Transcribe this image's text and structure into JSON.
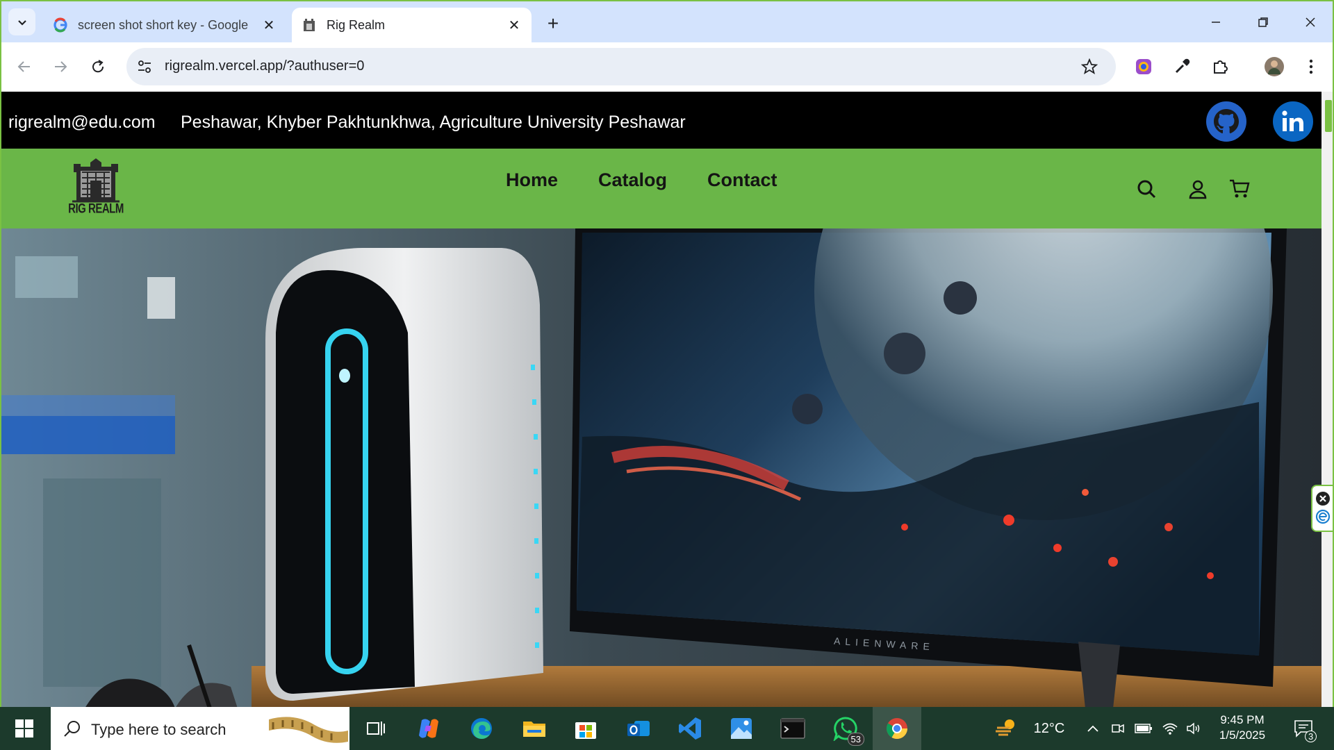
{
  "browser": {
    "tabs": [
      {
        "title": "screen shot short key - Google",
        "active": false
      },
      {
        "title": "Rig Realm",
        "active": true
      }
    ],
    "url": "rigrealm.vercel.app/?authuser=0"
  },
  "site": {
    "topbar": {
      "email": "rigrealm@edu.com",
      "address": "Peshawar, Khyber Pakhtunkhwa, Agriculture University Peshawar"
    },
    "logo_text": "RIG REALM",
    "nav": [
      {
        "label": "Home"
      },
      {
        "label": "Catalog"
      },
      {
        "label": "Contact"
      }
    ],
    "hero_monitor_brand": "ALIENWARE"
  },
  "colors": {
    "nav_green": "#6ab648",
    "topbar_black": "#000000",
    "github_blue": "#2563c9",
    "linkedin_blue": "#0a66c2"
  },
  "taskbar": {
    "search_placeholder": "Type here to search",
    "weather": "12°C",
    "time": "9:45 PM",
    "date": "1/5/2025",
    "whatsapp_badge": "53",
    "notification_badge": "3"
  }
}
